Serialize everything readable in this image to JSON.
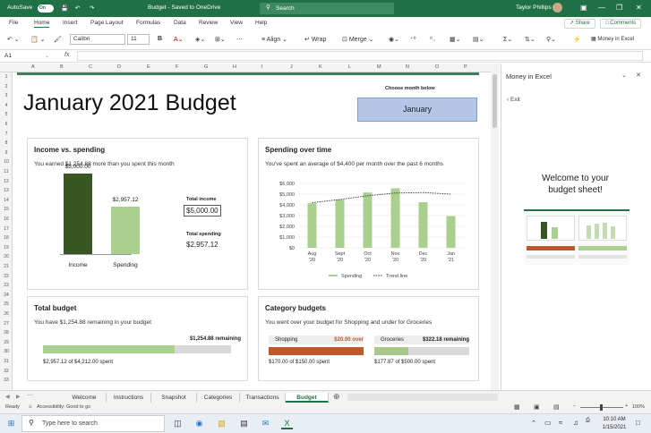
{
  "titlebar": {
    "autosave": "AutoSave",
    "autosave_state": "On",
    "doc_title": "Budget - Saved to OneDrive",
    "search_placeholder": "Search",
    "user": "Taylor Phillips"
  },
  "menu": {
    "items": [
      "File",
      "Home",
      "Insert",
      "Page Layout",
      "Formulas",
      "Data",
      "Review",
      "View",
      "Help"
    ],
    "share": "Share",
    "comments": "Comments"
  },
  "ribbon": {
    "font": "Calibri",
    "size": "11",
    "align": "Align",
    "wrap": "Wrap",
    "merge": "Merge",
    "money": "Money in Excel"
  },
  "formula": {
    "cell_ref": "A1",
    "fx": "fx"
  },
  "columns": [
    "A",
    "B",
    "C",
    "D",
    "E",
    "F",
    "G",
    "H",
    "I",
    "J",
    "K",
    "L",
    "M",
    "N",
    "O",
    "P"
  ],
  "rows": [
    "1",
    "2",
    "3",
    "4",
    "5",
    "6",
    "7",
    "8",
    "9",
    "10",
    "11",
    "12",
    "13",
    "14",
    "15",
    "16",
    "17",
    "18",
    "19",
    "20",
    "21",
    "22",
    "23",
    "24",
    "25",
    "26",
    "27",
    "28",
    "29",
    "30",
    "31",
    "32",
    "33"
  ],
  "sheet": {
    "title": "January 2021 Budget",
    "month_label": "Choose month below",
    "month_value": "January",
    "income_card": {
      "heading": "Income vs. spending",
      "subtitle": "You earned $1,254.88 more than you spent this month",
      "bars": [
        {
          "label": "Income",
          "value": 5000,
          "display": "$5,000.00"
        },
        {
          "label": "Spending",
          "value": 2957.12,
          "display": "$2,957.12"
        }
      ],
      "total_income_label": "Total income",
      "total_income": "$5,000.00",
      "total_spending_label": "Total spending",
      "total_spending": "$2,957.12"
    },
    "spending_card": {
      "heading": "Spending over time",
      "subtitle": "You've spent an average of $4,400 per month over the past 6 months"
    },
    "total_budget": {
      "heading": "Total budget",
      "subtitle": "You have $1,254.88 remaining in your budget",
      "remaining": "$1,254.88 remaining",
      "fill": 0.7,
      "footer": "$2,957.12 of $4,212.00 spent"
    },
    "category": {
      "heading": "Category budgets",
      "subtitle": "You went over your budget for Shopping and under for Groceries",
      "items": [
        {
          "name": "Shopping",
          "status": "$20.00 over",
          "fill": 1.0,
          "footer": "$170.00 of $150.00 spent",
          "color": "#c0582c"
        },
        {
          "name": "Groceries",
          "status": "$322.18 remaining",
          "fill": 0.36,
          "footer": "$177.87 of $500.00 spent",
          "color": "#a9c98c"
        }
      ]
    }
  },
  "chart_data": {
    "type": "line",
    "title": "",
    "categories": [
      "Aug '20",
      "Sept '20",
      "Oct '20",
      "Nov '20",
      "Dec '20",
      "Jan '21"
    ],
    "yticks": [
      "$6,000",
      "$5,000",
      "$4,000",
      "$3,000",
      "$2,000",
      "$1,000",
      "$0"
    ],
    "ylim": [
      0,
      6000
    ],
    "series": [
      {
        "name": "Spending",
        "values": [
          4150,
          4500,
          5150,
          5550,
          4250,
          2957
        ]
      },
      {
        "name": "Trend line",
        "values": [
          4200,
          4500,
          4850,
          5100,
          5150,
          5000
        ]
      }
    ],
    "bar_color": "#a9d08e"
  },
  "pane": {
    "title": "Money in Excel",
    "exit": "Exit",
    "welcome": "Welcome to your budget sheet!"
  },
  "tabs": [
    "Welcome",
    "Instructions",
    "Snapshot",
    "Categories",
    "Transactions",
    "Budget"
  ],
  "active_tab": "Budget",
  "status": {
    "ready": "Ready",
    "accessibility": "Accessibility: Good to go",
    "zoom": "100%"
  },
  "taskbar": {
    "search": "Type here to search",
    "time": "10:10 AM",
    "date": "1/15/2021"
  },
  "colors": {
    "excel_green": "#1f7145",
    "income_bar": "#375623",
    "spending_bar": "#a9d08e",
    "month_box": "#b4c7e7"
  }
}
